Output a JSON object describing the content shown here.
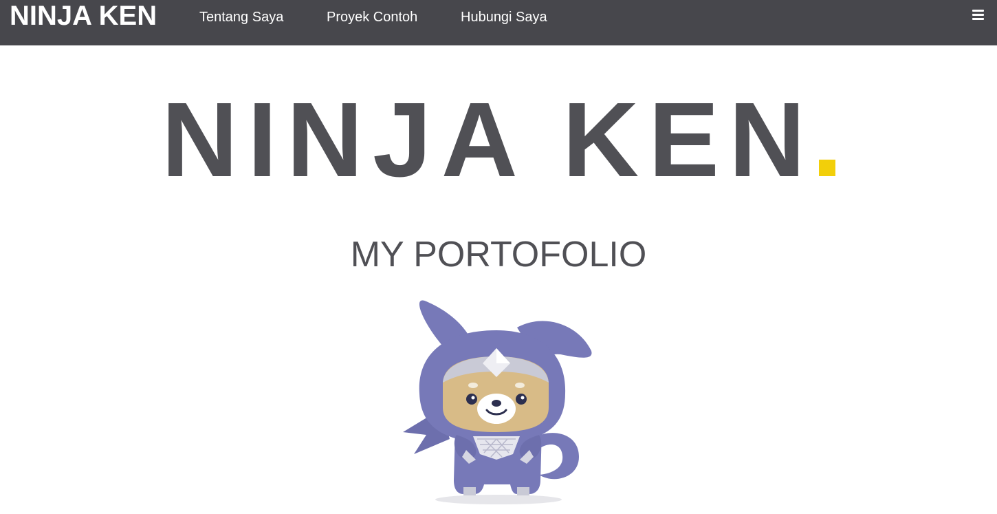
{
  "navbar": {
    "brand": "NINJA KEN",
    "links": [
      {
        "label": "Tentang Saya"
      },
      {
        "label": "Proyek Contoh"
      },
      {
        "label": "Hubungi Saya"
      }
    ],
    "menu_icon": "hamburger-menu-icon",
    "background": "#47474c"
  },
  "hero": {
    "title": "NINJA KEN",
    "title_color": "#505055",
    "accent_color": "#f2cf0a",
    "subtitle": "MY PORTOFOLIO"
  },
  "mascot": {
    "icon": "ninja-dog-mascot"
  }
}
